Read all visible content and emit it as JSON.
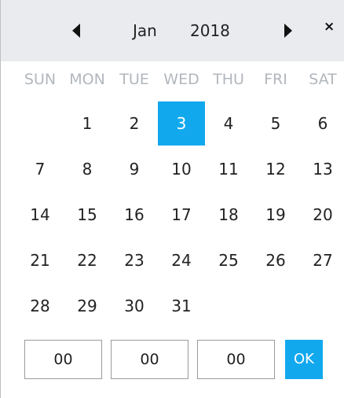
{
  "header": {
    "month": "Jan",
    "year": "2018",
    "prev_icon": "triangle-left-icon",
    "next_icon": "triangle-right-icon",
    "close_label": "×"
  },
  "weekdays": [
    "SUN",
    "MON",
    "TUE",
    "WED",
    "THU",
    "FRI",
    "SAT"
  ],
  "days": [
    "1",
    "2",
    "3",
    "4",
    "5",
    "6",
    "7",
    "8",
    "9",
    "10",
    "11",
    "12",
    "13",
    "14",
    "15",
    "16",
    "17",
    "18",
    "19",
    "20",
    "21",
    "22",
    "23",
    "24",
    "25",
    "26",
    "27",
    "28",
    "29",
    "30",
    "31"
  ],
  "selected_day": "3",
  "time": {
    "hour": "00",
    "minute": "00",
    "second": "00"
  },
  "ok_label": "OK",
  "colors": {
    "accent": "#12a8ee",
    "header_bg": "#e9ebee",
    "weekday_text": "#b2b7bd"
  }
}
